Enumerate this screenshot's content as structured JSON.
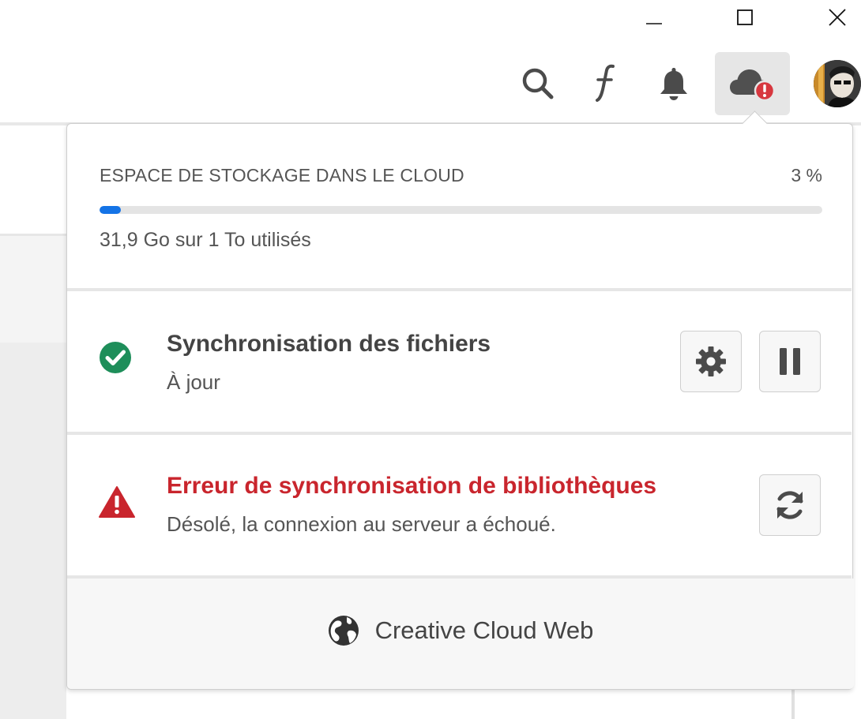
{
  "window_controls": {
    "minimize_icon": "minimize-icon",
    "maximize_icon": "maximize-icon",
    "close_icon": "close-icon"
  },
  "toolbar": {
    "items": [
      "search-icon",
      "fonts-icon",
      "bell-icon",
      "cloud-error-icon",
      "avatar"
    ],
    "active_item": "cloud-error-icon",
    "error_badge_color": "#d7373f"
  },
  "storage": {
    "title": "ESPACE DE STOCKAGE DANS LE CLOUD",
    "percent_label": "3 %",
    "percent_value": 0.03,
    "used_label": "31,9 Go sur 1 To utilisés",
    "bar_color": "#1473e6"
  },
  "file_sync": {
    "title": "Synchronisation des fichiers",
    "status": "À jour",
    "status_icon": "check-circle-icon",
    "status_color": "#1e8e5a",
    "actions": [
      "gear-icon",
      "pause-icon"
    ]
  },
  "library_sync": {
    "title": "Erreur de synchronisation de bibliothèques",
    "message": "Désolé, la connexion au serveur a échoué.",
    "status_icon": "warning-icon",
    "status_color": "#c9252d",
    "actions": [
      "refresh-icon"
    ]
  },
  "footer": {
    "link_label": "Creative Cloud Web",
    "icon": "globe-icon"
  }
}
